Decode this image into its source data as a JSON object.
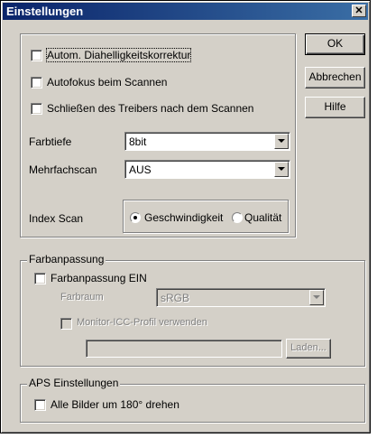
{
  "window": {
    "title": "Einstellungen",
    "close_glyph": "✕"
  },
  "buttons": {
    "ok": "OK",
    "cancel": "Abbrechen",
    "help": "Hilfe"
  },
  "main": {
    "auto_brightness": {
      "label": "Autom. Diahelligkeitskorrektur",
      "checked": false
    },
    "autofocus": {
      "label": "Autofokus beim Scannen",
      "checked": false
    },
    "close_driver": {
      "label": "Schließen des Treibers nach dem Scannen",
      "checked": false
    },
    "color_depth": {
      "label": "Farbtiefe",
      "value": "8bit"
    },
    "multiscan": {
      "label": "Mehrfachscan",
      "value": "AUS"
    },
    "index_scan": {
      "label": "Index Scan",
      "options": [
        "Geschwindigkeit",
        "Qualität"
      ],
      "selected": "Geschwindigkeit"
    }
  },
  "color_matching": {
    "legend": "Farbanpassung",
    "enable": {
      "label": "Farbanpassung EIN",
      "checked": false
    },
    "color_space": {
      "label": "Farbraum",
      "value": "sRGB"
    },
    "monitor_icc": {
      "label": "Monitor-ICC-Profil verwenden",
      "checked": false
    },
    "profile_path": "",
    "load_button": "Laden..."
  },
  "aps": {
    "legend": "APS Einstellungen",
    "rotate": {
      "label": "Alle Bilder um 180° drehen",
      "checked": false
    }
  }
}
